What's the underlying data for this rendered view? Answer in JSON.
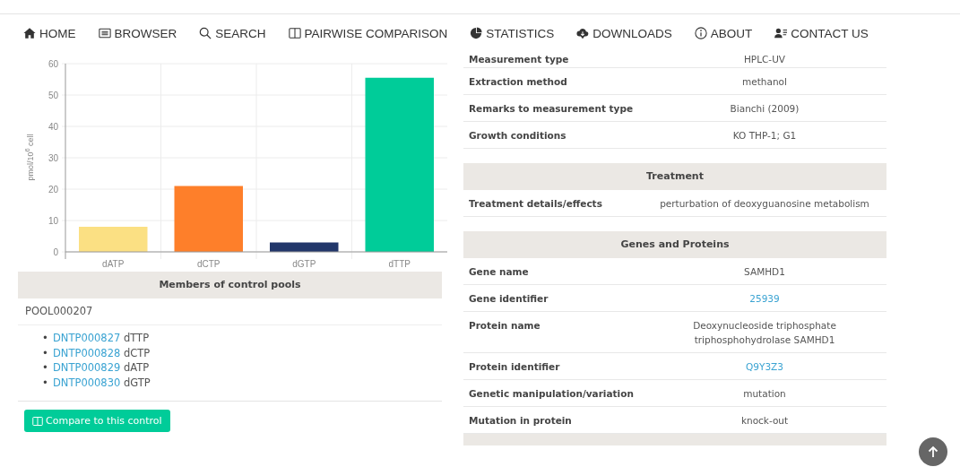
{
  "nav": [
    {
      "label": "HOME"
    },
    {
      "label": "BROWSER"
    },
    {
      "label": "SEARCH"
    },
    {
      "label": "PAIRWISE COMPARISON"
    },
    {
      "label": "STATISTICS"
    },
    {
      "label": "DOWNLOADS"
    },
    {
      "label": "ABOUT"
    },
    {
      "label": "CONTACT US"
    }
  ],
  "chart": {
    "chart_data": {
      "type": "bar",
      "ylabel": "pmol/10$^{6}$ cell",
      "series": [
        {
          "name": "dATP",
          "color": "#fbe083",
          "values": [
            8,
            null,
            null,
            null
          ]
        },
        {
          "name": "dCTP",
          "color": "#fe7f2a",
          "values": [
            null,
            21,
            null,
            null
          ]
        },
        {
          "name": "dGTP",
          "color": "#22376a",
          "values": [
            null,
            null,
            3,
            null
          ]
        },
        {
          "name": "dTTP",
          "color": "#00cc99",
          "values": [
            null,
            null,
            null,
            55.5
          ]
        }
      ],
      "stacked": true,
      "grid": true,
      "ylim": [
        0,
        60
      ],
      "yticks": [
        0,
        10,
        20,
        30,
        40,
        50,
        60
      ]
    }
  },
  "control_pools": {
    "title": "Members of control pools",
    "pool_id": "POOL000207",
    "members": [
      {
        "marker": "•",
        "id": "DNTP000827",
        "name": "dTTP"
      },
      {
        "marker": "•",
        "id": "DNTP000828",
        "name": "dCTP"
      },
      {
        "marker": "•",
        "id": "DNTP000829",
        "name": "dATP"
      },
      {
        "marker": "•",
        "id": "DNTP000830",
        "name": "dGTP"
      }
    ],
    "button": "Compare to this control"
  },
  "sections": [
    {
      "rows": [
        {
          "label": "Measurement type",
          "value": "HPLC-UV",
          "kind": "text"
        },
        {
          "label": "Extraction method",
          "value": "methanol",
          "kind": "text"
        },
        {
          "label": "Remarks to measurement type",
          "value": "Bianchi (2009)",
          "kind": "text"
        },
        {
          "label": "Growth conditions",
          "value": "KO THP-1; G1",
          "kind": "text"
        }
      ]
    },
    {
      "title": "Treatment",
      "rows": [
        {
          "label": "Treatment details/effects",
          "value": "perturbation of deoxyguanosine metabolism",
          "kind": "text"
        }
      ]
    },
    {
      "title": "Genes and Proteins",
      "rows": [
        {
          "label": "Gene name",
          "value": "SAMHD1",
          "kind": "text"
        },
        {
          "label": "Gene identifier",
          "value": "25939",
          "kind": "link"
        },
        {
          "label": "Protein name",
          "value": "Deoxynucleoside triphosphate triphosphohydrolase SAMHD1",
          "kind": "text"
        },
        {
          "label": "Protein identifier",
          "value": "Q9Y3Z3",
          "kind": "link"
        },
        {
          "label": "Genetic manipulation/variation",
          "value": "mutation",
          "kind": "text"
        },
        {
          "label": "Mutation in protein",
          "value": "knock-out",
          "kind": "text"
        }
      ]
    }
  ]
}
